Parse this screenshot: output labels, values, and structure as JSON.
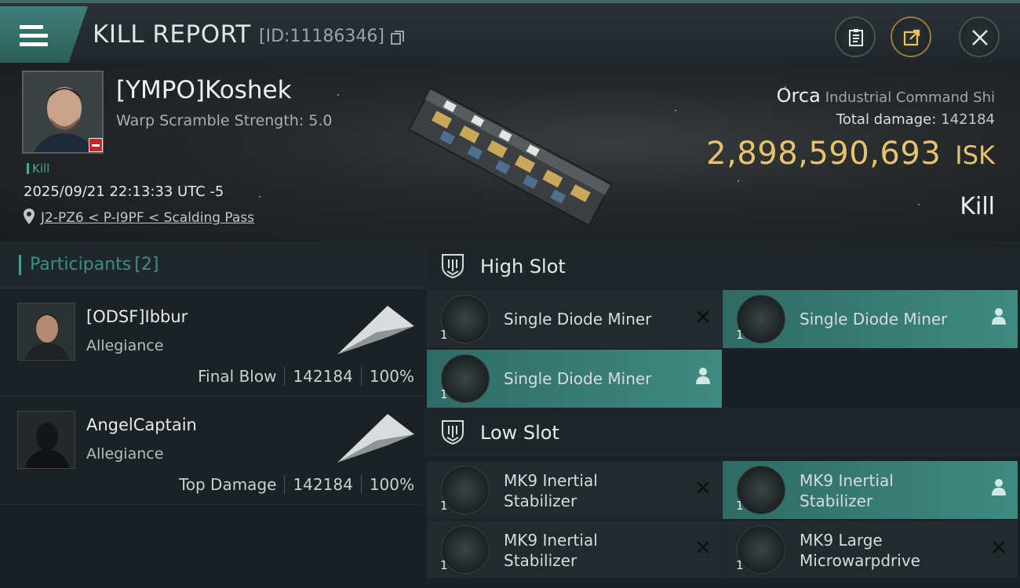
{
  "header": {
    "title": "KILL REPORT",
    "report_id": "[ID:11186346]"
  },
  "victim": {
    "name": "[YMPO]Koshek",
    "scramble": "Warp Scramble Strength: 5.0",
    "tag": "Kill",
    "timestamp": "2025/09/21 22:13:33 UTC -5",
    "location": "J2-PZ6 < P-I9PF < Scalding Pass",
    "ship_name": "Orca",
    "ship_class": "Industrial Command Shi",
    "total_damage_label": "Total damage:",
    "total_damage": "142184",
    "isk_value": "2,898,590,693",
    "isk_unit": "ISK",
    "result": "Kill"
  },
  "participants": {
    "title": "Participants",
    "count": "[2]",
    "items": [
      {
        "name": "[ODSF]Ibbur",
        "corp": "Allegiance",
        "role": "Final Blow",
        "damage": "142184",
        "percent": "100%"
      },
      {
        "name": "AngelCaptain",
        "corp": "Allegiance",
        "role": "Top Damage",
        "damage": "142184",
        "percent": "100%"
      }
    ]
  },
  "fitting": {
    "high_slot": {
      "title": "High Slot",
      "items": [
        {
          "name": "Single Diode Miner",
          "qty": "1",
          "status": "destroyed"
        },
        {
          "name": "Single Diode Miner",
          "qty": "1",
          "status": "dropped"
        },
        {
          "name": "Single Diode Miner",
          "qty": "1",
          "status": "dropped"
        }
      ]
    },
    "low_slot": {
      "title": "Low Slot",
      "items": [
        {
          "name": "MK9 Inertial Stabilizer",
          "qty": "1",
          "status": "destroyed"
        },
        {
          "name": "MK9 Inertial Stabilizer",
          "qty": "1",
          "status": "dropped"
        },
        {
          "name": "MK9 Inertial Stabilizer",
          "qty": "1",
          "status": "destroyed"
        },
        {
          "name": "MK9 Large Microwarpdrive",
          "qty": "1",
          "status": "destroyed"
        }
      ]
    }
  },
  "colors": {
    "accent_teal": "#3f8a81",
    "isk_gold": "#e8c36d",
    "danger_red": "#c9262a"
  },
  "icons": [
    "menu-icon",
    "copy-icon",
    "clipboard-icon",
    "share-icon",
    "close-icon",
    "location-pin-icon",
    "shield-slot-icon",
    "destroyed-x-icon",
    "dropped-user-icon"
  ]
}
